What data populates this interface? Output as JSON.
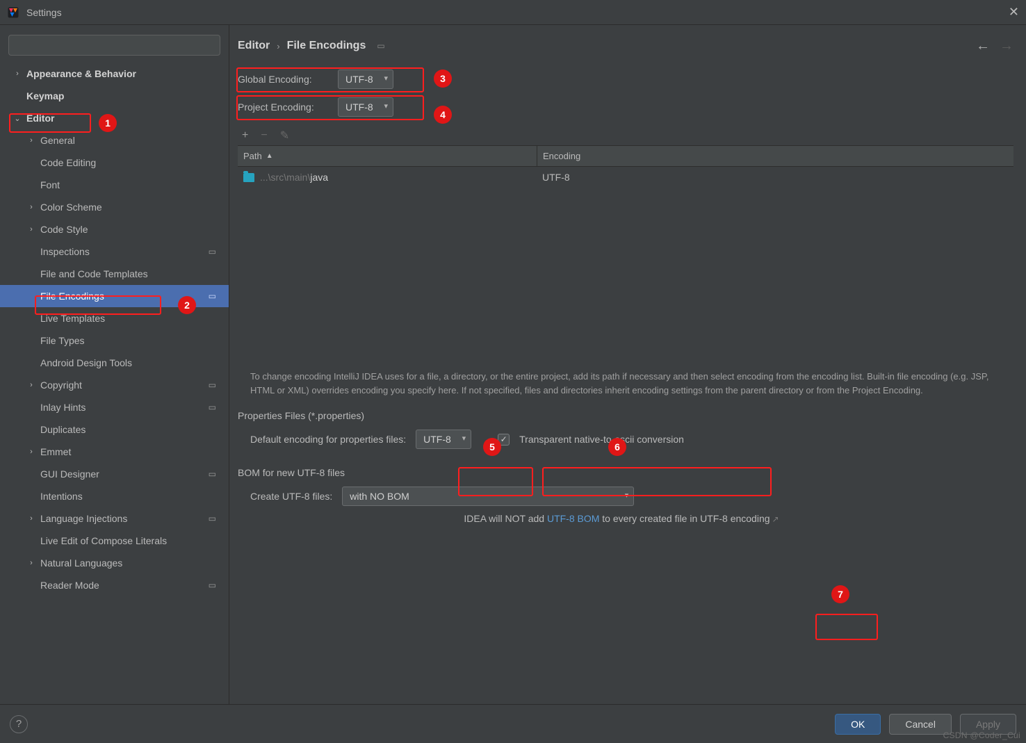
{
  "window": {
    "title": "Settings"
  },
  "search": {
    "placeholder": ""
  },
  "sidebar": {
    "items": [
      {
        "label": "Appearance & Behavior",
        "expandable": true,
        "expanded": false,
        "bold": true,
        "level": 0
      },
      {
        "label": "Keymap",
        "expandable": false,
        "bold": true,
        "level": 0
      },
      {
        "label": "Editor",
        "expandable": true,
        "expanded": true,
        "bold": true,
        "level": 0,
        "highlight_red": true
      },
      {
        "label": "General",
        "expandable": true,
        "expanded": false,
        "level": 1
      },
      {
        "label": "Code Editing",
        "level": 1
      },
      {
        "label": "Font",
        "level": 1
      },
      {
        "label": "Color Scheme",
        "expandable": true,
        "expanded": false,
        "level": 1
      },
      {
        "label": "Code Style",
        "expandable": true,
        "expanded": false,
        "level": 1
      },
      {
        "label": "Inspections",
        "level": 1,
        "project_scope": true
      },
      {
        "label": "File and Code Templates",
        "level": 1
      },
      {
        "label": "File Encodings",
        "level": 1,
        "project_scope": true,
        "selected": true,
        "highlight_red": true
      },
      {
        "label": "Live Templates",
        "level": 1
      },
      {
        "label": "File Types",
        "level": 1
      },
      {
        "label": "Android Design Tools",
        "level": 1
      },
      {
        "label": "Copyright",
        "expandable": true,
        "expanded": false,
        "level": 1,
        "project_scope": true
      },
      {
        "label": "Inlay Hints",
        "level": 1,
        "project_scope": true
      },
      {
        "label": "Duplicates",
        "level": 1
      },
      {
        "label": "Emmet",
        "expandable": true,
        "expanded": false,
        "level": 1
      },
      {
        "label": "GUI Designer",
        "level": 1,
        "project_scope": true
      },
      {
        "label": "Intentions",
        "level": 1
      },
      {
        "label": "Language Injections",
        "expandable": true,
        "expanded": false,
        "level": 1,
        "project_scope": true
      },
      {
        "label": "Live Edit of Compose Literals",
        "level": 1
      },
      {
        "label": "Natural Languages",
        "expandable": true,
        "expanded": false,
        "level": 1
      },
      {
        "label": "Reader Mode",
        "level": 1,
        "project_scope": true
      }
    ]
  },
  "breadcrumb": {
    "root": "Editor",
    "leaf": "File Encodings"
  },
  "encoding": {
    "global_label": "Global Encoding:",
    "global_value": "UTF-8",
    "project_label": "Project Encoding:",
    "project_value": "UTF-8"
  },
  "table": {
    "col_path": "Path",
    "col_encoding": "Encoding",
    "rows": [
      {
        "path_dim": "...\\src\\main\\",
        "path_bright": "java",
        "encoding": "UTF-8"
      }
    ]
  },
  "help_text": "To change encoding IntelliJ IDEA uses for a file, a directory, or the entire project, add its path if necessary and then select encoding from the encoding list. Built-in file encoding (e.g. JSP, HTML or XML) overrides encoding you specify here. If not specified, files and directories inherit encoding settings from the parent directory or from the Project Encoding.",
  "properties": {
    "section_title": "Properties Files (*.properties)",
    "default_label": "Default encoding for properties files:",
    "default_value": "UTF-8",
    "checkbox_checked": true,
    "checkbox_label": "Transparent native-to-ascii conversion"
  },
  "bom": {
    "section_title": "BOM for new UTF-8 files",
    "create_label": "Create UTF-8 files:",
    "create_value": "with NO BOM",
    "note_prefix": "IDEA will NOT add ",
    "note_link": "UTF-8 BOM",
    "note_suffix": " to every created file in UTF-8 encoding"
  },
  "buttons": {
    "ok": "OK",
    "cancel": "Cancel",
    "apply": "Apply"
  },
  "callouts": {
    "c1": "1",
    "c2": "2",
    "c3": "3",
    "c4": "4",
    "c5": "5",
    "c6": "6",
    "c7": "7"
  },
  "watermark": "CSDN @Coder_Cui"
}
